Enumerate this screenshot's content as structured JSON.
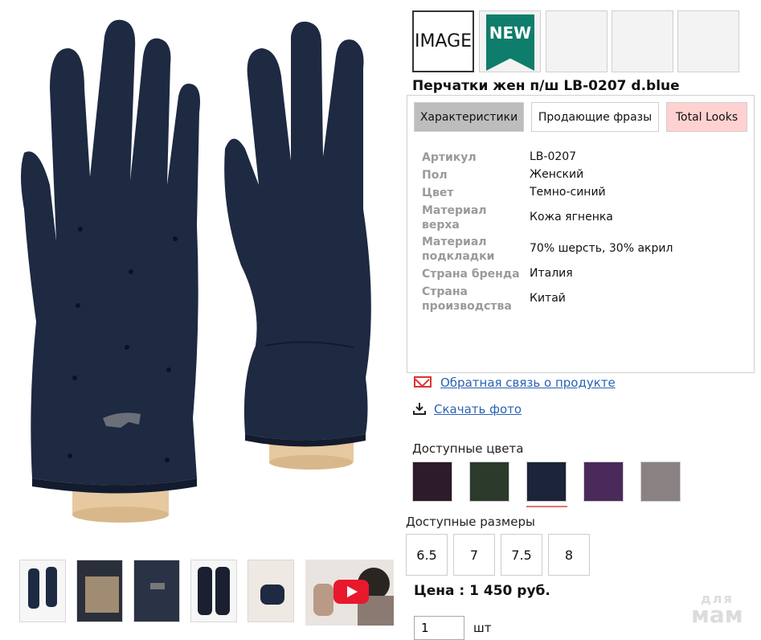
{
  "colors": {
    "glove": "#1e2942",
    "glove_shade": "#131b2e",
    "stand": "#e6c9a0",
    "accent_link": "#2a62b5",
    "tab_active": "#bdbdbd",
    "tab_looks": "#ffd1d1",
    "new_badge": "#0f7d6b"
  },
  "badges": {
    "image_label": "IMAGE",
    "new_label": "NEW"
  },
  "product": {
    "title": "Перчатки жен п/ш LB-0207 d.blue"
  },
  "tabs": [
    {
      "label": "Характеристики",
      "active": true
    },
    {
      "label": "Продающие фразы",
      "active": false
    },
    {
      "label": "Total Looks",
      "active": false
    }
  ],
  "specs": [
    {
      "label": "Артикул",
      "value": "LB-0207"
    },
    {
      "label": "Пол",
      "value": "Женский"
    },
    {
      "label": "Цвет",
      "value": "Темно-синий"
    },
    {
      "label": "Материал верха",
      "value": "Кожа ягненка"
    },
    {
      "label": "Материал подкладки",
      "value": "70% шерсть, 30% акрил"
    },
    {
      "label": "Страна бренда",
      "value": "Италия"
    },
    {
      "label": "Страна производства",
      "value": "Китай"
    }
  ],
  "links": {
    "feedback": "Обратная связь о продукте",
    "download": "Скачать фото"
  },
  "colors_section": {
    "label": "Доступные цвета",
    "swatches": [
      "#2d1a2a",
      "#2c3a2c",
      "#1b2438",
      "#4a2a5a",
      "#8a8282"
    ]
  },
  "sizes_section": {
    "label": "Доступные размеры",
    "sizes": [
      "6.5",
      "7",
      "7.5",
      "8"
    ]
  },
  "price": "Цена : 1 450 руб.",
  "quantity": {
    "value": "1",
    "unit": "шт"
  },
  "watermark": {
    "small": "для",
    "big": "мам"
  }
}
